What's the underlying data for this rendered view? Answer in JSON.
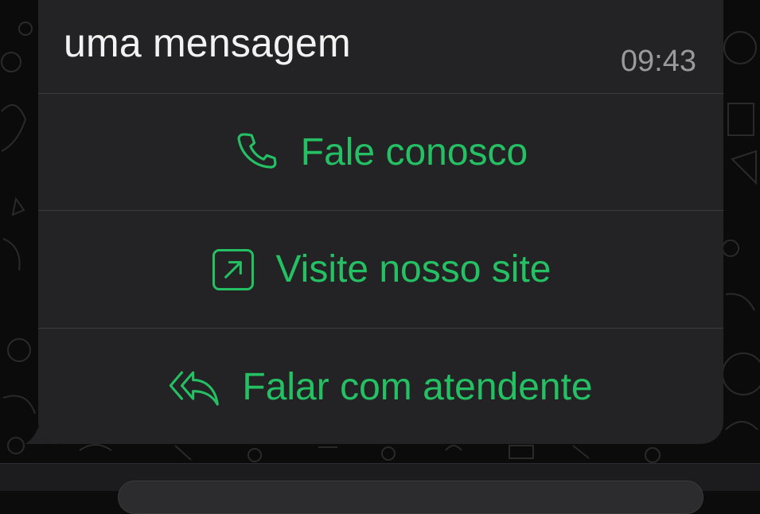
{
  "message": {
    "text": "uma mensagem",
    "time": "09:43"
  },
  "actions": [
    {
      "label": "Fale conosco",
      "icon": "phone-icon"
    },
    {
      "label": "Visite nosso site",
      "icon": "external-link-icon"
    },
    {
      "label": "Falar com atendente",
      "icon": "reply-all-icon"
    }
  ],
  "colors": {
    "bubble": "#232325",
    "action_text": "#25c063",
    "time_text": "#9a9a9e",
    "message_text": "#f2f2f2"
  }
}
